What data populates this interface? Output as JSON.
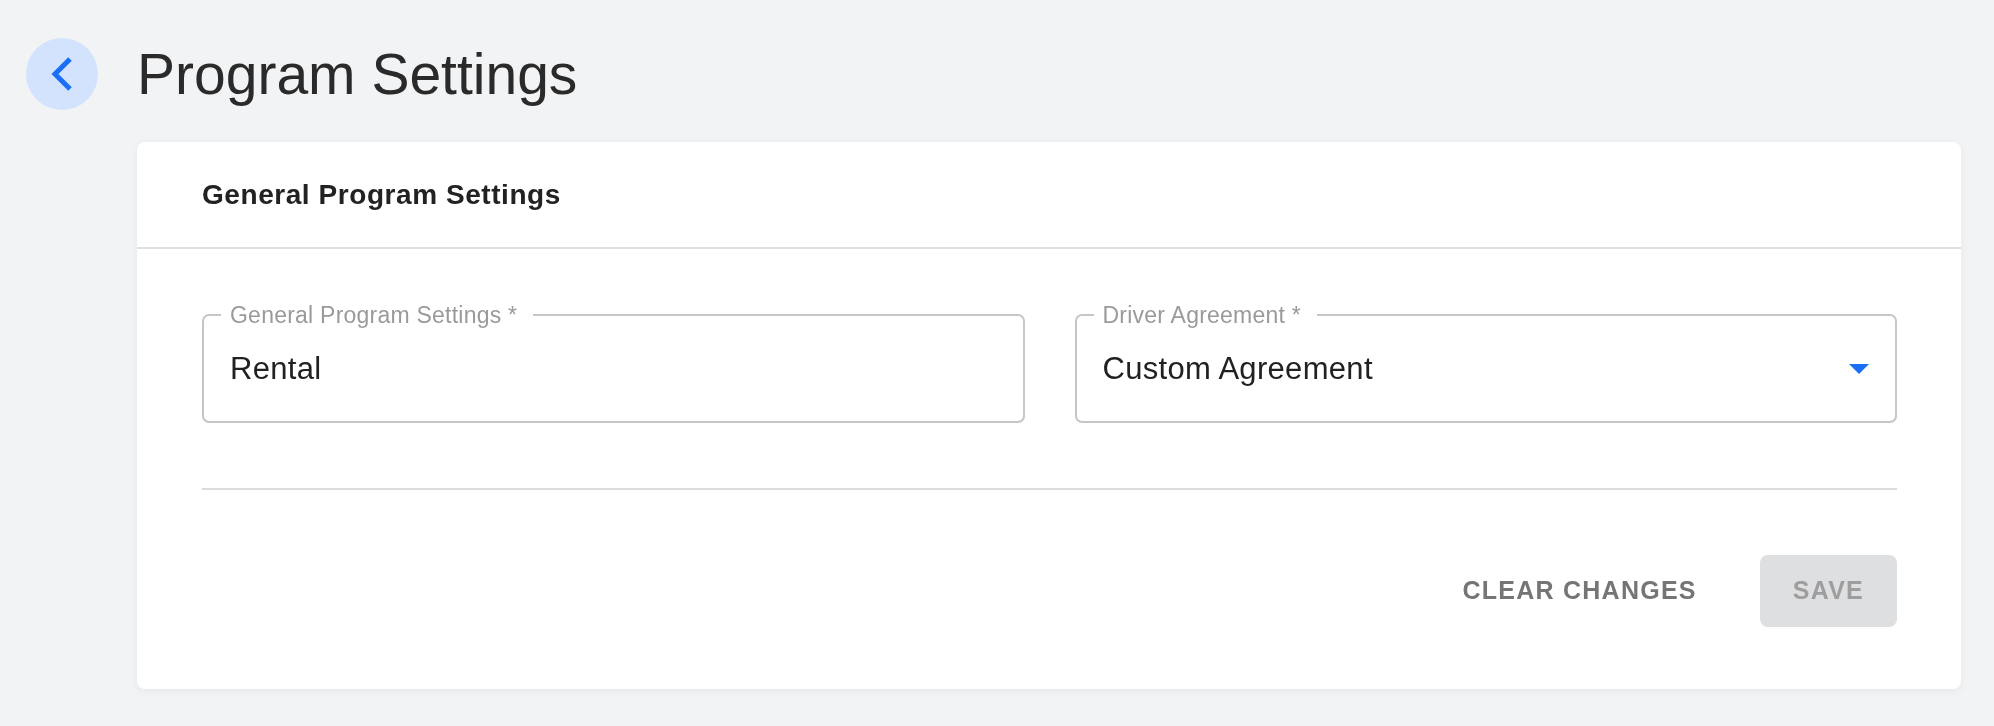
{
  "page": {
    "title": "Program Settings"
  },
  "card": {
    "title": "General Program Settings",
    "fields": [
      {
        "kind": "text",
        "label": "General Program Settings *",
        "value": "Rental"
      },
      {
        "kind": "select",
        "label": "Driver Agreement *",
        "value": "Custom Agreement"
      }
    ],
    "actions": [
      {
        "kind": "text",
        "label": "CLEAR CHANGES",
        "disabled": false
      },
      {
        "kind": "filled",
        "label": "SAVE",
        "disabled": true
      }
    ]
  }
}
